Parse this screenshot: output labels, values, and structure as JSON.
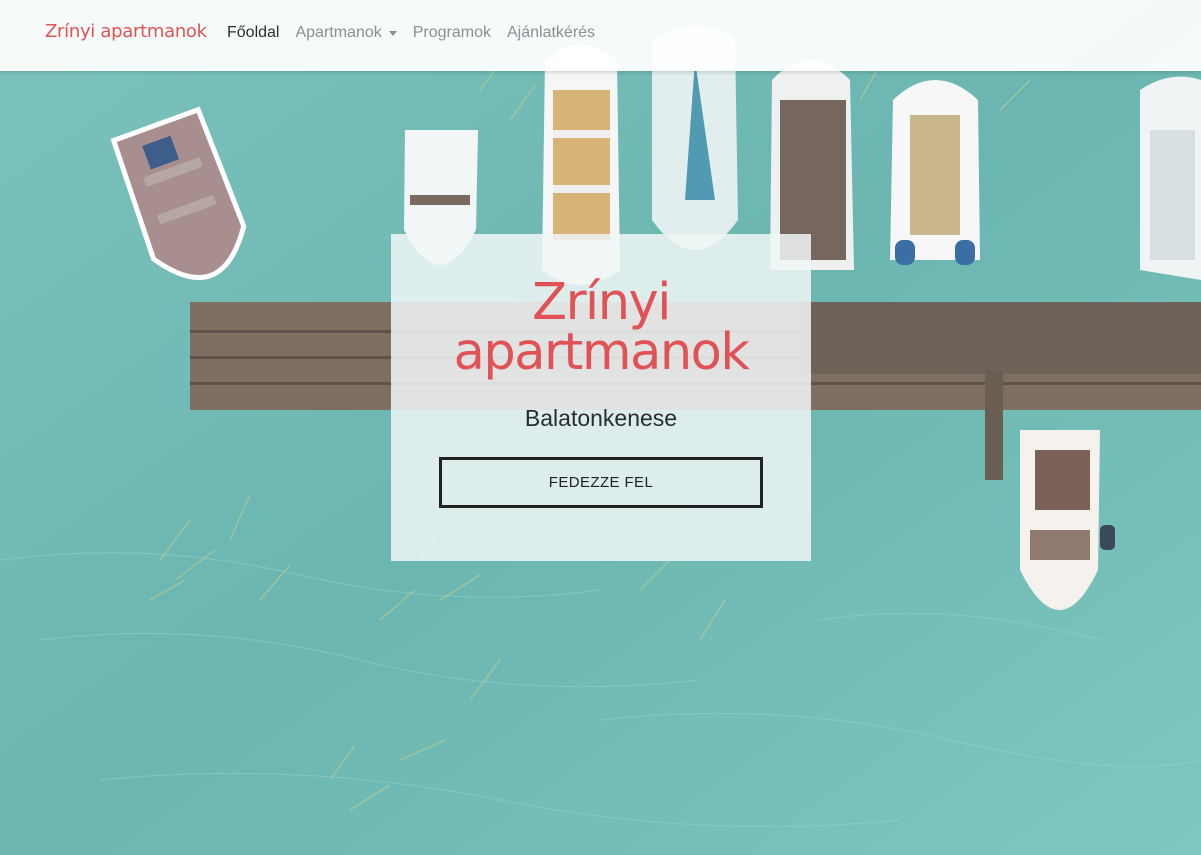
{
  "navbar": {
    "brand": "Zrínyi apartmanok",
    "items": [
      {
        "label": "Főoldal",
        "active": true
      },
      {
        "label": "Apartmanok",
        "dropdown": true
      },
      {
        "label": "Programok"
      },
      {
        "label": "Ajánlatkérés"
      }
    ]
  },
  "hero": {
    "title_line1": "Zrínyi",
    "title_line2": "apartmanok",
    "subtitle": "Balatonkenese",
    "button_label": "FEDEZZE FEL"
  },
  "colors": {
    "brand": "#e05256",
    "water": "#6fb8b4",
    "text_dark": "#2a2d30",
    "nav_muted": "#8c8f92"
  }
}
